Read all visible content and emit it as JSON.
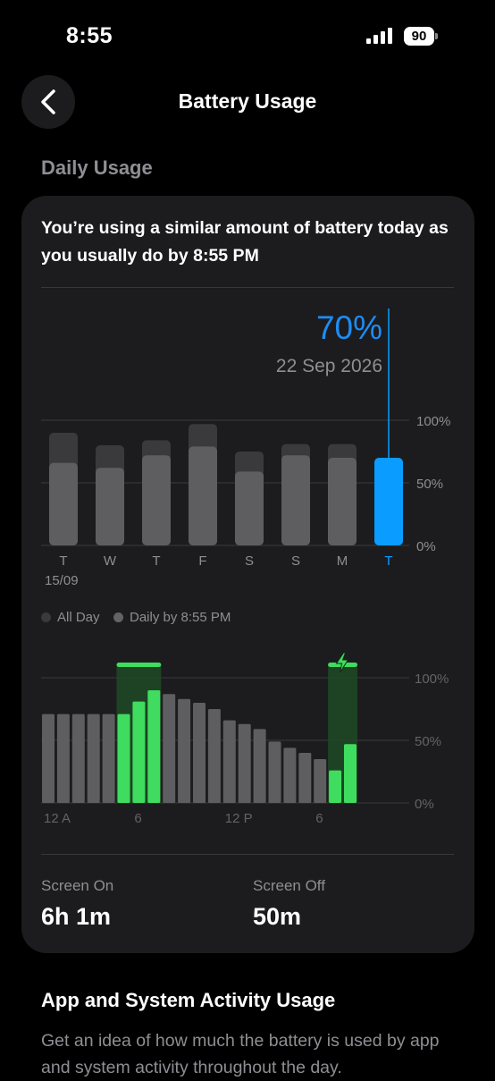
{
  "status_bar": {
    "time": "8:55",
    "battery": "90"
  },
  "nav": {
    "title": "Battery Usage"
  },
  "section": {
    "title": "Daily Usage"
  },
  "card": {
    "summary": "You’re using a similar amount of battery today as you usually do by 8:55 PM",
    "selected": {
      "value": "70%",
      "date": "22 Sep 2026"
    }
  },
  "chart_data": [
    {
      "type": "bar",
      "categories": [
        "T",
        "W",
        "T",
        "F",
        "S",
        "S",
        "M",
        "T"
      ],
      "date_label": "15/09",
      "series": [
        {
          "name": "All Day",
          "values": [
            90,
            80,
            84,
            97,
            75,
            81,
            81,
            0
          ]
        },
        {
          "name": "Daily by 8:55 PM",
          "values": [
            66,
            62,
            72,
            79,
            59,
            72,
            70,
            70
          ]
        }
      ],
      "selected_index": 7,
      "y_ticks": [
        "100%",
        "50%",
        "0%"
      ],
      "ylim": [
        0,
        100
      ],
      "colors": {
        "all_day": "#3a3a3d",
        "daily": "#5e5e61",
        "selected": "#0a9cff"
      },
      "legend": [
        "All Day",
        "Daily by 8:55 PM"
      ]
    },
    {
      "type": "bar",
      "values": [
        71,
        71,
        71,
        71,
        71,
        71,
        81,
        90,
        87,
        83,
        80,
        75,
        66,
        63,
        59,
        49,
        44,
        40,
        35,
        26,
        47
      ],
      "charging": [
        false,
        false,
        false,
        false,
        false,
        true,
        true,
        true,
        false,
        false,
        false,
        false,
        false,
        false,
        false,
        false,
        false,
        false,
        false,
        true,
        true
      ],
      "x_ticks": [
        "12 A",
        "6",
        "12 P",
        "6"
      ],
      "y_ticks": [
        "100%",
        "50%",
        "0%"
      ],
      "ylim": [
        0,
        100
      ],
      "colors": {
        "normal": "#5e5e61",
        "charging": "#3fdc5f",
        "charging_band": "#1f4a26"
      }
    }
  ],
  "stats": [
    {
      "label": "Screen On",
      "value": "6h 1m"
    },
    {
      "label": "Screen Off",
      "value": "50m"
    }
  ],
  "app_section": {
    "title": "App and System Activity Usage",
    "description": "Get an idea of how much the battery is used by app and system activity throughout the day."
  }
}
